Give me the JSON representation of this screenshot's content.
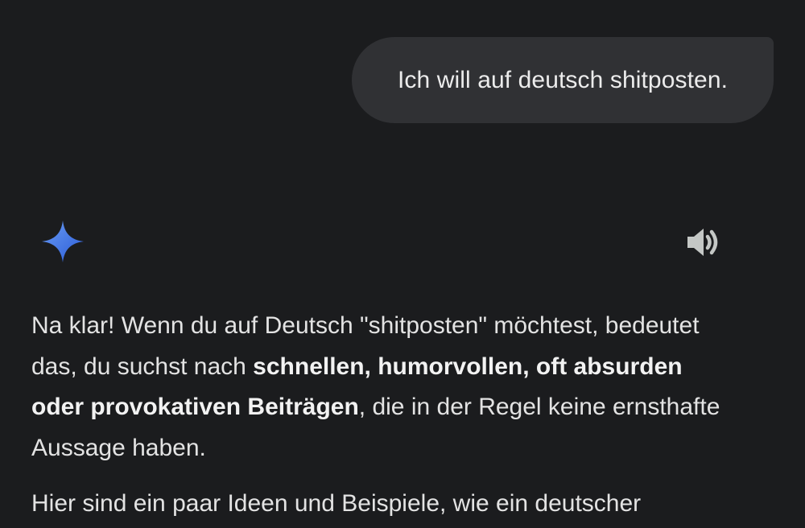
{
  "user_message": {
    "text": "Ich will auf deutsch shitposten."
  },
  "assistant": {
    "avatar_icon": "gemini-sparkle-icon",
    "speaker_icon": "volume-icon",
    "paragraph1": {
      "line1": "Na klar! Wenn du auf Deutsch \"shitposten\" möchtest, bedeutet",
      "line2_plain": "das, du suchst nach ",
      "line2_bold": "schnellen, humorvollen, oft absurden",
      "line3_bold": "oder provokativen Beiträgen",
      "line3_plain": ", die in der Regel keine ernsthafte",
      "line4": "Aussage haben."
    },
    "paragraph2": {
      "line1": "Hier sind ein paar Ideen und Beispiele, wie ein deutscher"
    }
  },
  "colors": {
    "background": "#1b1c1e",
    "bubble": "#303134",
    "text": "#e3e3e3",
    "sparkle_top": "#5b8def",
    "sparkle_bottom": "#2f5fd6",
    "icon_gray": "#c4c7c5"
  }
}
